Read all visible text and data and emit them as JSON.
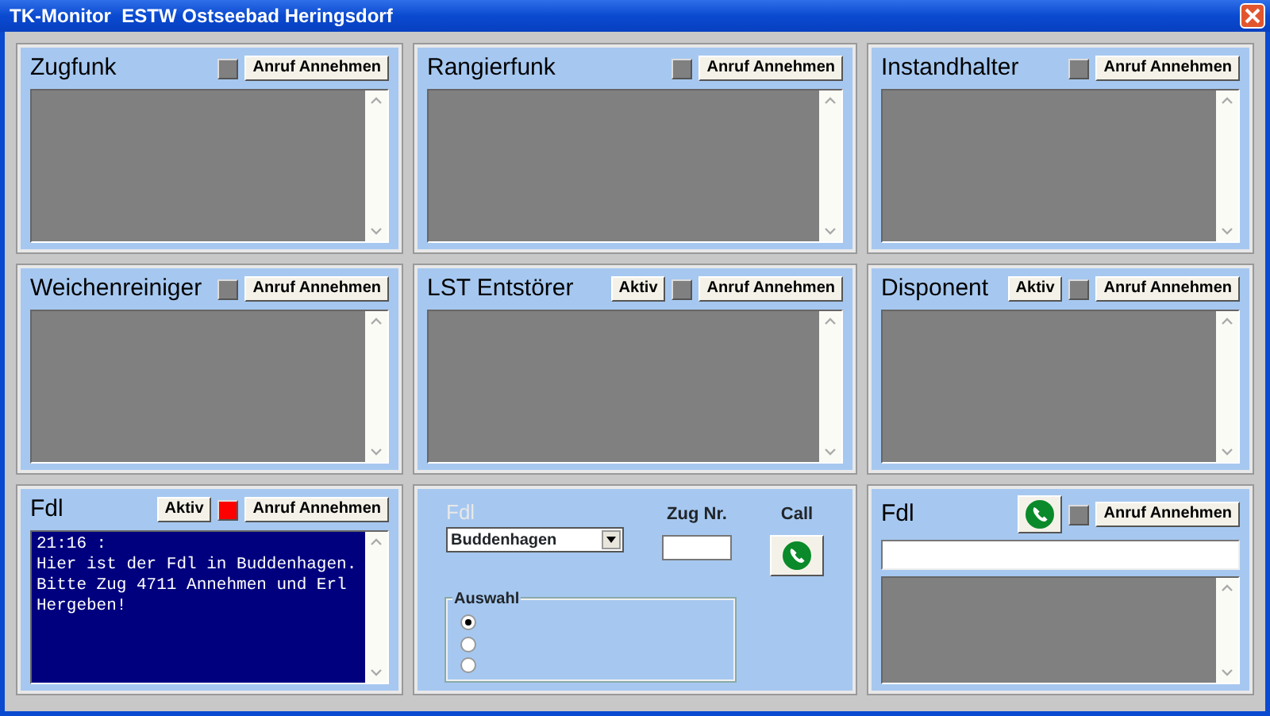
{
  "window": {
    "title": "TK-Monitor  ESTW Ostseebad Heringsdorf"
  },
  "panels": [
    {
      "kind": "channel",
      "title": "Zugfunk",
      "indicator": {
        "color": "#808080"
      },
      "answer_button": "Anruf Annehmen",
      "screen": {
        "kind": "idle"
      }
    },
    {
      "kind": "channel",
      "title": "Rangierfunk",
      "indicator": {
        "color": "#808080"
      },
      "answer_button": "Anruf Annehmen",
      "screen": {
        "kind": "idle"
      }
    },
    {
      "kind": "channel",
      "title": "Instandhalter",
      "indicator": {
        "color": "#808080"
      },
      "answer_button": "Anruf Annehmen",
      "screen": {
        "kind": "idle"
      }
    },
    {
      "kind": "channel",
      "title": "Weichenreiniger",
      "indicator": {
        "color": "#808080"
      },
      "answer_button": "Anruf Annehmen",
      "screen": {
        "kind": "idle"
      }
    },
    {
      "kind": "channel",
      "title": "LST Entstörer",
      "active_button": "Aktiv",
      "indicator": {
        "color": "#808080"
      },
      "answer_button": "Anruf Annehmen",
      "screen": {
        "kind": "idle"
      }
    },
    {
      "kind": "channel",
      "title": "Disponent",
      "active_button": "Aktiv",
      "indicator": {
        "color": "#808080"
      },
      "answer_button": "Anruf Annehmen",
      "screen": {
        "kind": "idle"
      }
    },
    {
      "kind": "channel",
      "title": "Fdl",
      "active_button": "Aktiv",
      "indicator": {
        "color": "#ff0000"
      },
      "answer_button": "Anruf Annehmen",
      "screen": {
        "kind": "message",
        "lines": [
          "21:16 :",
          "Hier ist der Fdl in Buddenhagen.",
          "Bitte Zug 4711 Annehmen und Erl Hergeben!"
        ]
      }
    },
    {
      "kind": "dial",
      "station_label": {
        "text": "Fdl",
        "disabled": true
      },
      "station_select": "Buddenhagen",
      "train_label": "Zug Nr.",
      "call_label": "Call",
      "group_title": "Auswahl",
      "options": [
        {
          "selected": true
        },
        {
          "selected": false
        },
        {
          "selected": false
        }
      ]
    },
    {
      "kind": "channel",
      "title": "Fdl",
      "call_button": true,
      "indicator": {
        "color": "#808080"
      },
      "answer_button": "Anruf Annehmen",
      "input": true,
      "screen": {
        "kind": "idle"
      }
    }
  ]
}
